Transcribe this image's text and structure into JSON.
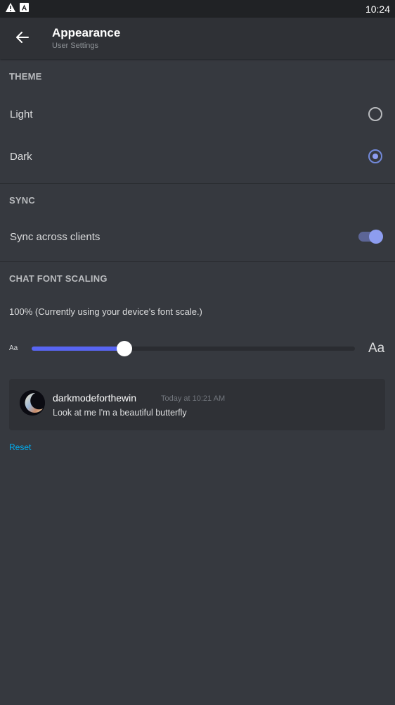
{
  "status_bar": {
    "time": "10:24",
    "icons": [
      "warning-icon",
      "app-notification-icon"
    ]
  },
  "header": {
    "title": "Appearance",
    "subtitle": "User Settings",
    "back_icon": "arrow-left-icon"
  },
  "theme": {
    "section_title": "THEME",
    "options": [
      {
        "label": "Light",
        "selected": false
      },
      {
        "label": "Dark",
        "selected": true
      }
    ]
  },
  "sync": {
    "section_title": "SYNC",
    "label": "Sync across clients",
    "enabled": true
  },
  "font_scaling": {
    "section_title": "CHAT FONT SCALING",
    "description": "100% (Currently using your device's font scale.)",
    "small_label": "Aa",
    "large_label": "Aa",
    "slider_value": 0.286
  },
  "preview": {
    "username": "darkmodeforthewin",
    "timestamp": "Today at 10:21 AM",
    "message": "Look at me I'm a beautiful butterfly"
  },
  "reset_label": "Reset",
  "colors": {
    "background": "#36393f",
    "header": "#2f3136",
    "accent": "#5865f2",
    "radio_selected": "#8d9df0",
    "link": "#00b0f4"
  }
}
